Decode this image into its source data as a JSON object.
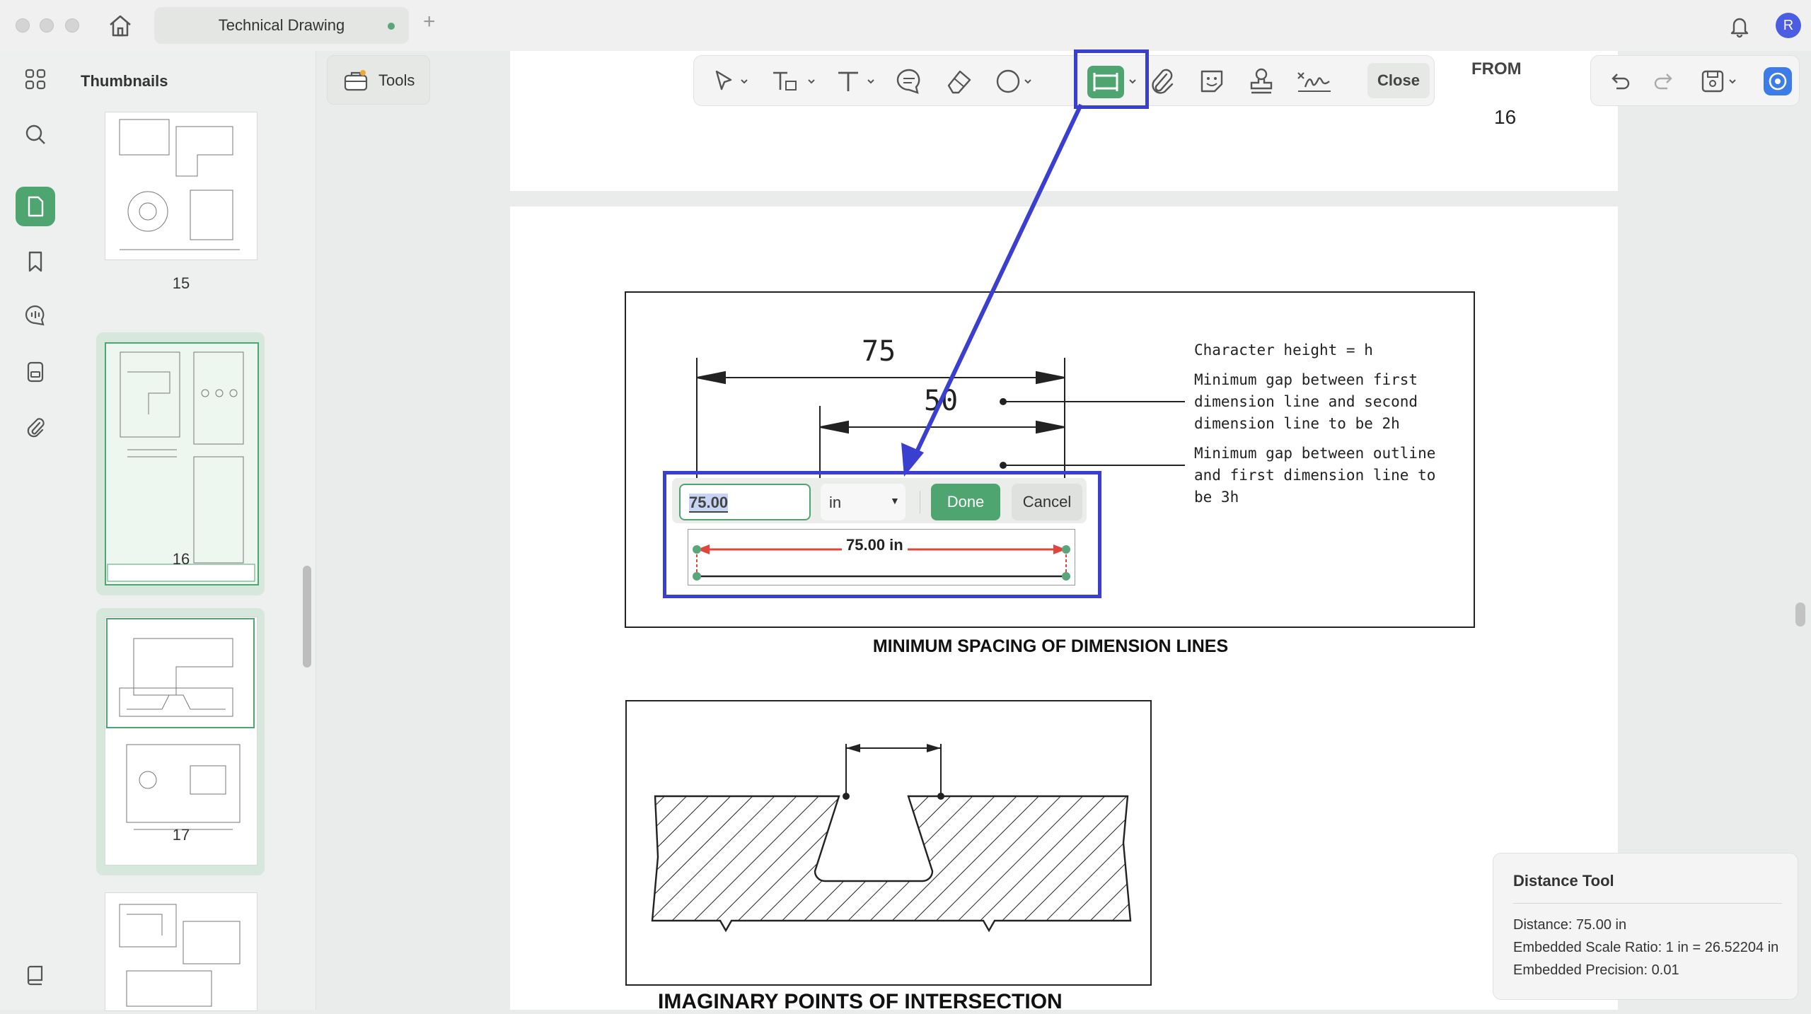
{
  "window": {
    "tab_title": "Technical Drawing",
    "avatar_initial": "R"
  },
  "sidebar": {
    "panel_title": "Thumbnails",
    "thumbnails": [
      {
        "page": "15"
      },
      {
        "page": "16"
      },
      {
        "page": "17"
      }
    ]
  },
  "toolbar": {
    "tools_label": "Tools",
    "close_label": "Close"
  },
  "document": {
    "partial_heading": "FROM",
    "page_number": "16",
    "figure1": {
      "dim_outer": "75",
      "dim_inner": "50",
      "note1": "Character height = h",
      "note2_lines": [
        "Minimum gap between first",
        "dimension line and second",
        "dimension line to be 2h"
      ],
      "note3_lines": [
        "Minimum gap between outline",
        "and first dimension line to",
        "be 3h"
      ],
      "caption": "MINIMUM SPACING OF DIMENSION LINES"
    },
    "figure2": {
      "caption": "IMAGINARY POINTS OF INTERSECTION"
    }
  },
  "measure": {
    "value": "75.00",
    "unit": "in",
    "done_label": "Done",
    "cancel_label": "Cancel",
    "line_label": "75.00 in"
  },
  "info_panel": {
    "title": "Distance Tool",
    "distance": "Distance: 75.00 in",
    "scale_ratio": "Embedded Scale Ratio: 1 in = 26.52204 in",
    "precision": "Embedded Precision: 0.01"
  },
  "colors": {
    "accent_green": "#4fa56f",
    "highlight_blue": "#3b3fd0",
    "measure_red": "#e2453c"
  }
}
